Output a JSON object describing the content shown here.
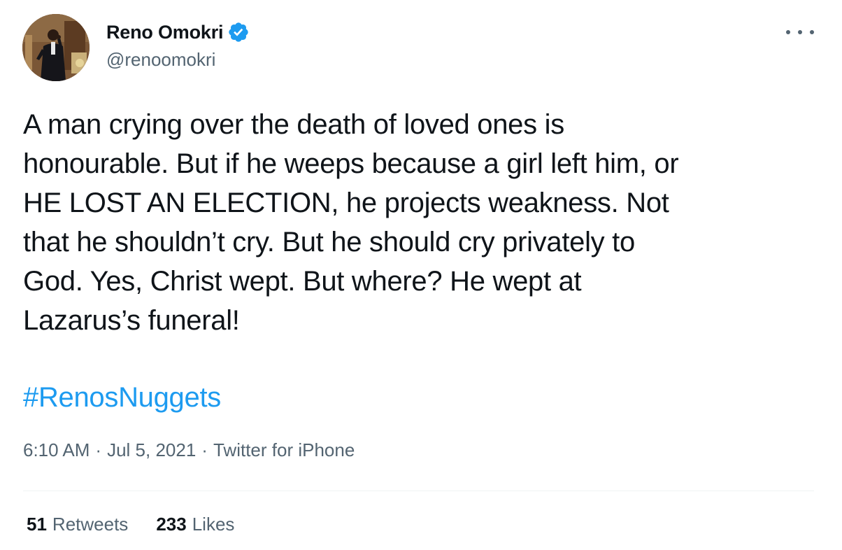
{
  "author": {
    "display_name": "Reno Omokri",
    "handle": "@renoomokri",
    "verified": true,
    "avatar_icon": "profile-photo-man-speaking-at-podium"
  },
  "tweet": {
    "text": "A man crying over the death of loved ones is\nhonourable. But if he weeps because a girl left him, or\nHE LOST AN ELECTION, he projects weakness. Not\nthat he shouldn’t cry. But he should cry privately to\nGod. Yes, Christ wept. But where? He wept at\nLazarus’s funeral!",
    "hashtag": "#RenosNuggets"
  },
  "meta": {
    "time": "6:10 AM",
    "separator": "·",
    "date": "Jul 5, 2021",
    "source": "Twitter for iPhone"
  },
  "stats": {
    "retweets_count": "51",
    "retweets_label": "Retweets",
    "likes_count": "233",
    "likes_label": "Likes"
  },
  "colors": {
    "text_primary": "#0f1419",
    "text_secondary": "#536471",
    "link": "#1d9bf0",
    "verified_badge": "#1d9bf0",
    "divider": "#eff3f4"
  },
  "icons": {
    "verified": "verified-badge-icon",
    "more": "more-options-icon"
  }
}
